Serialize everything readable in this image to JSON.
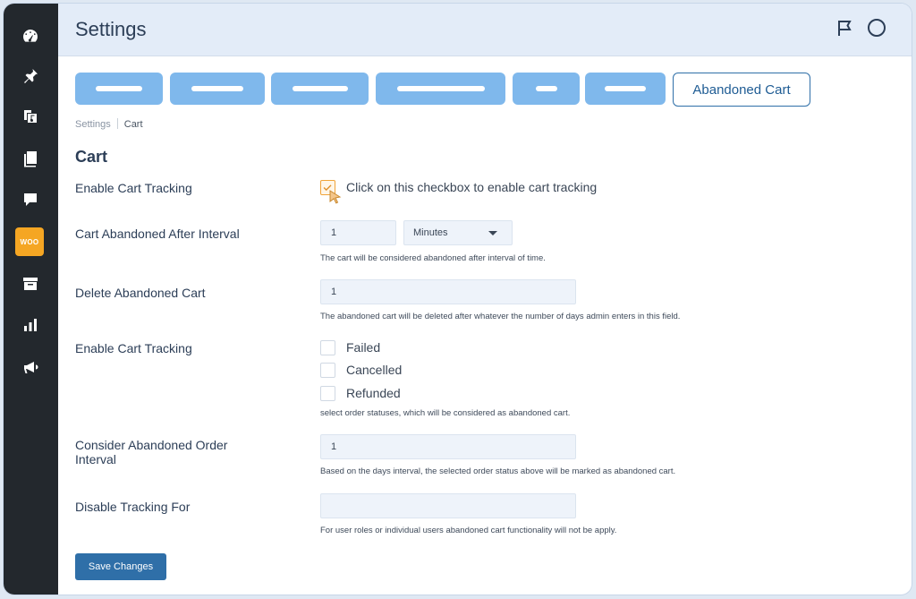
{
  "header": {
    "title": "Settings",
    "icons": [
      "flag-icon",
      "circle-icon"
    ]
  },
  "sidebar": {
    "items": [
      {
        "name": "dashboard-icon"
      },
      {
        "name": "pin-icon"
      },
      {
        "name": "media-icon"
      },
      {
        "name": "pages-icon"
      },
      {
        "name": "comments-icon"
      },
      {
        "name": "woocommerce-icon",
        "label": "WOO",
        "active": true
      },
      {
        "name": "products-icon"
      },
      {
        "name": "analytics-icon"
      },
      {
        "name": "marketing-icon"
      }
    ]
  },
  "tabs": {
    "active_label": "Abandoned Cart"
  },
  "breadcrumb": {
    "root": "Settings",
    "current": "Cart"
  },
  "section": {
    "title": "Cart"
  },
  "fields": {
    "tracking": {
      "label": "Enable Cart Tracking",
      "checkbox_label": "Click on this checkbox to enable cart tracking",
      "checked": true
    },
    "interval": {
      "label": "Cart Abandoned After Interval",
      "value": "1",
      "unit": "Minutes",
      "help": "The cart will be considered abandoned after interval of time."
    },
    "delete": {
      "label": "Delete Abandoned Cart",
      "value": "1",
      "help": "The abandoned cart will be deleted after whatever the number of days admin enters in this field."
    },
    "statuses": {
      "label": "Enable Cart Tracking",
      "options": [
        "Failed",
        "Cancelled",
        "Refunded"
      ],
      "help": "select order statuses, which will be considered as abandoned cart."
    },
    "order_interval": {
      "label": "Consider Abandoned Order Interval",
      "value": "1",
      "help": "Based on the days interval, the selected order status above will be marked as abandoned cart."
    },
    "disable": {
      "label": "Disable Tracking For",
      "value": "",
      "help": "For user roles or individual users abandoned cart functionality will not be apply."
    }
  },
  "actions": {
    "save_label": "Save Changes"
  },
  "colors": {
    "accent": "#2f6fa8",
    "tab_inactive": "#7fb8ec",
    "sidebar": "#23282d",
    "active_sidebar": "#f5a623"
  }
}
